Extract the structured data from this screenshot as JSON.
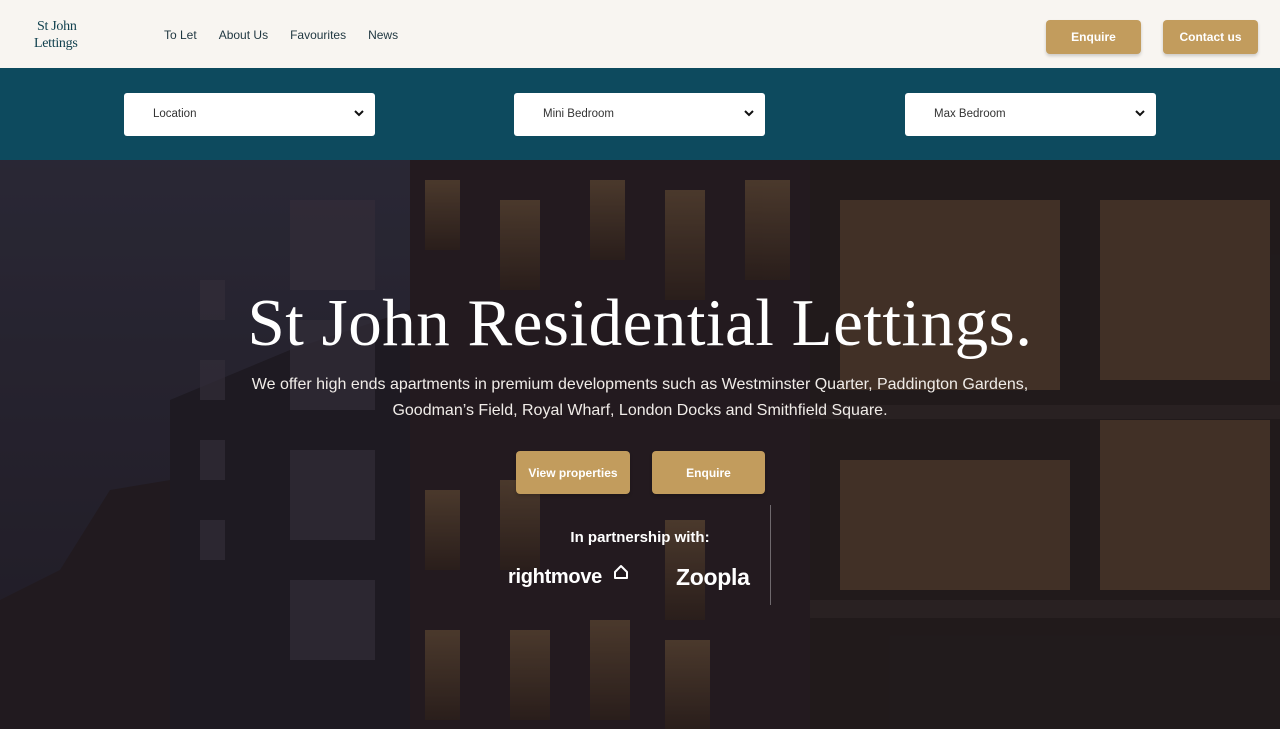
{
  "header": {
    "logo_line1": "St John",
    "logo_line2": "Lettings",
    "nav": [
      {
        "label": "To Let"
      },
      {
        "label": "About Us"
      },
      {
        "label": "Favourites"
      },
      {
        "label": "News"
      }
    ],
    "enquire_label": "Enquire",
    "contact_label": "Contact us"
  },
  "search": {
    "location": "Location",
    "min_bedroom": "Mini Bedroom",
    "max_bedroom": "Max Bedroom"
  },
  "hero": {
    "title": "St John Residential Lettings.",
    "subtitle_line1": "We offer high ends apartments in premium developments such as Westminster Quarter, Paddington Gardens,",
    "subtitle_line2": "Goodman’s Field, Royal Wharf, London Docks and Smithfield Square.",
    "view_properties_label": "View properties",
    "enquire_label": "Enquire",
    "partnership_label": "In partnership with:",
    "partners": [
      {
        "name": "rightmove",
        "icon": "house-outline-icon"
      },
      {
        "name": "Zoopla"
      }
    ]
  },
  "colors": {
    "gold": "#c29c5d",
    "teal": "#0d4a5e",
    "header_bg": "#f8f5f1"
  }
}
